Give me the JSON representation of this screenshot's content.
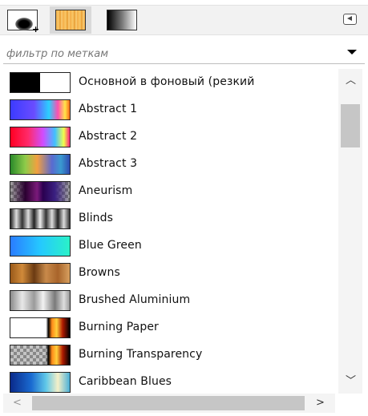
{
  "toolbar": {
    "tabs": [
      {
        "name": "brushes",
        "icon": "brush-icon"
      },
      {
        "name": "patterns",
        "icon": "pattern-icon",
        "active": true
      },
      {
        "name": "gradients",
        "icon": "gradient-icon"
      }
    ],
    "menu_icon": "panel-menu-icon"
  },
  "filter": {
    "placeholder": "фильтр по меткам"
  },
  "gradients": [
    {
      "label": "Основной в фоновый (резкий",
      "swatch": "linear-gradient(90deg,#000 0%,#000 50%,#fff 50%,#fff 100%)"
    },
    {
      "label": "Abstract 1",
      "swatch": "linear-gradient(90deg,#3b3bff 0%,#6a4cff 40%,#2ad0ff 65%,#ff4fb0 80%,#ffe54a 92%,#ff6a1a 100%)"
    },
    {
      "label": "Abstract 2",
      "swatch": "linear-gradient(90deg,#ff0022 0%,#ff2a6a 30%,#d04cff 55%,#40c0ff 75%,#f0ff4a 90%,#ff2080 100%)"
    },
    {
      "label": "Abstract 3",
      "swatch": "linear-gradient(90deg,#2a8a2a 0%,#8ecb4a 25%,#f2a040 45%,#5a6ad0 70%,#3a9ad0 85%,#2f4ab0 100%)"
    },
    {
      "label": "Aneurism",
      "swatch": "linear-gradient(90deg,rgba(0,0,0,0.15) 0%,#2a0030 25%,#7a1a7a 45%,#2a0050 55%,#3a2080 75%,rgba(0,0,0,0.15) 100%)",
      "checker": true
    },
    {
      "label": "Blinds",
      "swatch": "linear-gradient(90deg,#222 0%,#ddd 10%,#333 20%,#ddd 30%,#222 40%,#eee 50%,#333 60%,#ddd 70%,#222 80%,#ddd 90%,#333 100%)"
    },
    {
      "label": "Blue Green",
      "swatch": "linear-gradient(90deg,#2a7cff 0%,#25c8ff 50%,#2af2c8 100%)"
    },
    {
      "label": "Browns",
      "swatch": "linear-gradient(90deg,#9a5a1a 0%,#d08a3a 20%,#6a3a12 40%,#c88a4a 60%,#a8642a 80%,#d8a060 100%)"
    },
    {
      "label": "Brushed Aluminium",
      "swatch": "linear-gradient(90deg,#8a8a8a 0%,#e8e8e8 20%,#9a9a9a 40%,#f2f2f2 55%,#7a7a7a 75%,#dedede 90%,#9a9a9a 100%)"
    },
    {
      "label": "Burning Paper",
      "swatch": "linear-gradient(90deg,#fff 0%,#fff 60%,#000 64%,#ff8a1a 70%,#ffcf3a 78%,#b01a00 88%,#000 100%)"
    },
    {
      "label": "Burning Transparency",
      "swatch": "linear-gradient(90deg,rgba(0,0,0,0) 0%,rgba(0,0,0,0) 60%,#000 64%,#ff8a1a 70%,#ffcf3a 78%,#b01a00 88%,#000 100%)",
      "checker": true
    },
    {
      "label": "Caribbean Blues",
      "swatch": "linear-gradient(90deg,#0a2a8a 0%,#1a6ad0 35%,#60c8e8 60%,#f5f0c8 80%,#4ab0d8 100%)"
    }
  ],
  "scroll": {
    "up_icon": "chevron-up-icon",
    "down_icon": "chevron-down-icon",
    "left_icon": "chevron-left-icon",
    "right_icon": "chevron-right-icon"
  }
}
